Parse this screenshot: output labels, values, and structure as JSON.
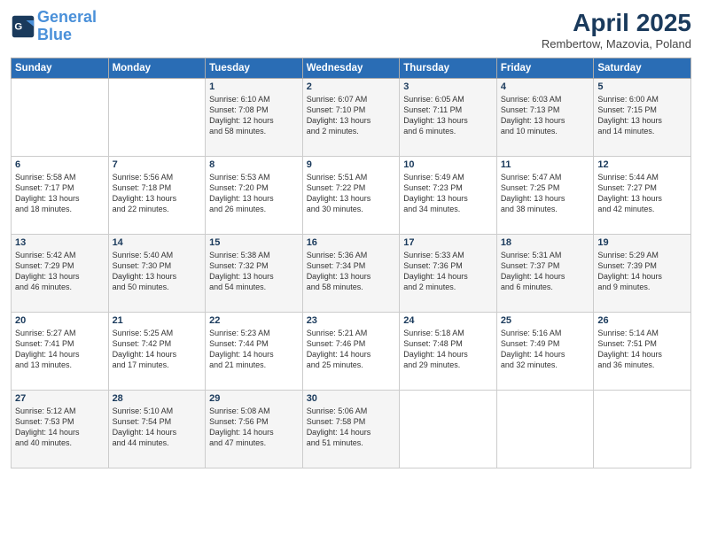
{
  "header": {
    "logo_line1": "General",
    "logo_line2": "Blue",
    "month_title": "April 2025",
    "subtitle": "Rembertow, Mazovia, Poland"
  },
  "weekdays": [
    "Sunday",
    "Monday",
    "Tuesday",
    "Wednesday",
    "Thursday",
    "Friday",
    "Saturday"
  ],
  "weeks": [
    [
      {
        "day": "",
        "info": ""
      },
      {
        "day": "",
        "info": ""
      },
      {
        "day": "1",
        "info": "Sunrise: 6:10 AM\nSunset: 7:08 PM\nDaylight: 12 hours\nand 58 minutes."
      },
      {
        "day": "2",
        "info": "Sunrise: 6:07 AM\nSunset: 7:10 PM\nDaylight: 13 hours\nand 2 minutes."
      },
      {
        "day": "3",
        "info": "Sunrise: 6:05 AM\nSunset: 7:11 PM\nDaylight: 13 hours\nand 6 minutes."
      },
      {
        "day": "4",
        "info": "Sunrise: 6:03 AM\nSunset: 7:13 PM\nDaylight: 13 hours\nand 10 minutes."
      },
      {
        "day": "5",
        "info": "Sunrise: 6:00 AM\nSunset: 7:15 PM\nDaylight: 13 hours\nand 14 minutes."
      }
    ],
    [
      {
        "day": "6",
        "info": "Sunrise: 5:58 AM\nSunset: 7:17 PM\nDaylight: 13 hours\nand 18 minutes."
      },
      {
        "day": "7",
        "info": "Sunrise: 5:56 AM\nSunset: 7:18 PM\nDaylight: 13 hours\nand 22 minutes."
      },
      {
        "day": "8",
        "info": "Sunrise: 5:53 AM\nSunset: 7:20 PM\nDaylight: 13 hours\nand 26 minutes."
      },
      {
        "day": "9",
        "info": "Sunrise: 5:51 AM\nSunset: 7:22 PM\nDaylight: 13 hours\nand 30 minutes."
      },
      {
        "day": "10",
        "info": "Sunrise: 5:49 AM\nSunset: 7:23 PM\nDaylight: 13 hours\nand 34 minutes."
      },
      {
        "day": "11",
        "info": "Sunrise: 5:47 AM\nSunset: 7:25 PM\nDaylight: 13 hours\nand 38 minutes."
      },
      {
        "day": "12",
        "info": "Sunrise: 5:44 AM\nSunset: 7:27 PM\nDaylight: 13 hours\nand 42 minutes."
      }
    ],
    [
      {
        "day": "13",
        "info": "Sunrise: 5:42 AM\nSunset: 7:29 PM\nDaylight: 13 hours\nand 46 minutes."
      },
      {
        "day": "14",
        "info": "Sunrise: 5:40 AM\nSunset: 7:30 PM\nDaylight: 13 hours\nand 50 minutes."
      },
      {
        "day": "15",
        "info": "Sunrise: 5:38 AM\nSunset: 7:32 PM\nDaylight: 13 hours\nand 54 minutes."
      },
      {
        "day": "16",
        "info": "Sunrise: 5:36 AM\nSunset: 7:34 PM\nDaylight: 13 hours\nand 58 minutes."
      },
      {
        "day": "17",
        "info": "Sunrise: 5:33 AM\nSunset: 7:36 PM\nDaylight: 14 hours\nand 2 minutes."
      },
      {
        "day": "18",
        "info": "Sunrise: 5:31 AM\nSunset: 7:37 PM\nDaylight: 14 hours\nand 6 minutes."
      },
      {
        "day": "19",
        "info": "Sunrise: 5:29 AM\nSunset: 7:39 PM\nDaylight: 14 hours\nand 9 minutes."
      }
    ],
    [
      {
        "day": "20",
        "info": "Sunrise: 5:27 AM\nSunset: 7:41 PM\nDaylight: 14 hours\nand 13 minutes."
      },
      {
        "day": "21",
        "info": "Sunrise: 5:25 AM\nSunset: 7:42 PM\nDaylight: 14 hours\nand 17 minutes."
      },
      {
        "day": "22",
        "info": "Sunrise: 5:23 AM\nSunset: 7:44 PM\nDaylight: 14 hours\nand 21 minutes."
      },
      {
        "day": "23",
        "info": "Sunrise: 5:21 AM\nSunset: 7:46 PM\nDaylight: 14 hours\nand 25 minutes."
      },
      {
        "day": "24",
        "info": "Sunrise: 5:18 AM\nSunset: 7:48 PM\nDaylight: 14 hours\nand 29 minutes."
      },
      {
        "day": "25",
        "info": "Sunrise: 5:16 AM\nSunset: 7:49 PM\nDaylight: 14 hours\nand 32 minutes."
      },
      {
        "day": "26",
        "info": "Sunrise: 5:14 AM\nSunset: 7:51 PM\nDaylight: 14 hours\nand 36 minutes."
      }
    ],
    [
      {
        "day": "27",
        "info": "Sunrise: 5:12 AM\nSunset: 7:53 PM\nDaylight: 14 hours\nand 40 minutes."
      },
      {
        "day": "28",
        "info": "Sunrise: 5:10 AM\nSunset: 7:54 PM\nDaylight: 14 hours\nand 44 minutes."
      },
      {
        "day": "29",
        "info": "Sunrise: 5:08 AM\nSunset: 7:56 PM\nDaylight: 14 hours\nand 47 minutes."
      },
      {
        "day": "30",
        "info": "Sunrise: 5:06 AM\nSunset: 7:58 PM\nDaylight: 14 hours\nand 51 minutes."
      },
      {
        "day": "",
        "info": ""
      },
      {
        "day": "",
        "info": ""
      },
      {
        "day": "",
        "info": ""
      }
    ]
  ]
}
